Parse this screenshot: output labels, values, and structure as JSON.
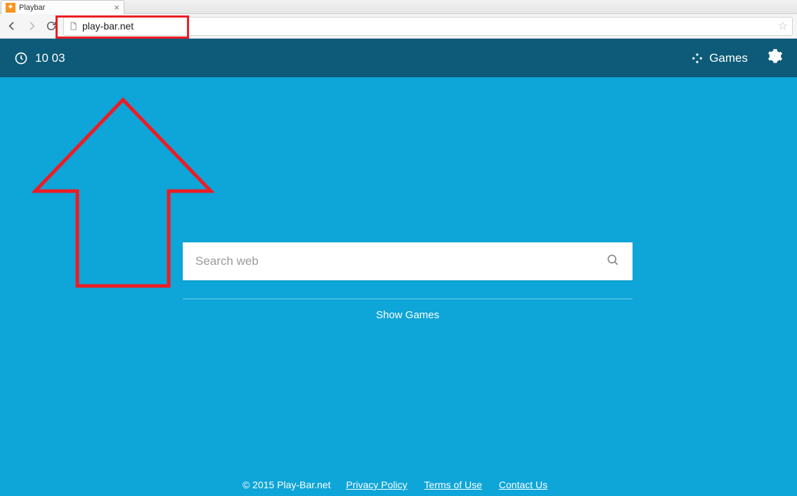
{
  "browser": {
    "tab_title": "Playbar",
    "url": "play-bar.net"
  },
  "topbar": {
    "time": "10 03",
    "games_label": "Games"
  },
  "search": {
    "placeholder": "Search web"
  },
  "show_games_label": "Show Games",
  "footer": {
    "copyright": "© 2015 Play-Bar.net",
    "links": [
      "Privacy Policy",
      "Terms of Use",
      "Contact Us"
    ]
  },
  "annotations": {
    "highlight_target": "address-bar",
    "arrow_points_to": "address-bar"
  }
}
